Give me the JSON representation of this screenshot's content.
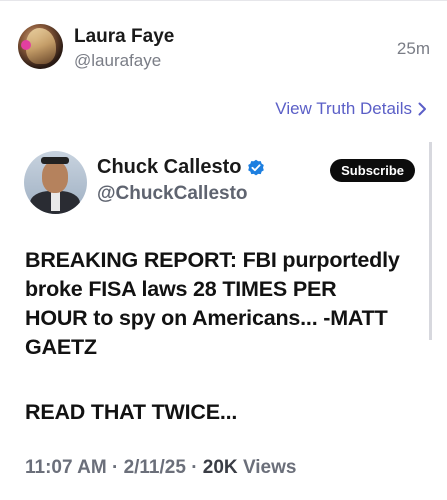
{
  "post": {
    "author_name": "Laura Faye",
    "author_handle": "@laurafaye",
    "time_ago": "25m",
    "view_details_label": "View Truth Details",
    "icons": {
      "chevron": "chevron-right-icon"
    }
  },
  "quoted": {
    "name": "Chuck Callesto",
    "handle": "@ChuckCallesto",
    "subscribe_label": "Subscribe",
    "verified": true,
    "colors": {
      "verified": "#1d7fe0",
      "link": "#5b5fc7"
    },
    "body_lines": [
      "BREAKING REPORT: FBI purportedly",
      "broke FISA laws 28 TIMES PER",
      "HOUR to spy on Americans... -MATT",
      "GAETZ"
    ],
    "body_second": "READ THAT TWICE...",
    "time": "11:07 AM",
    "date": "2/11/25",
    "views_count": "20K",
    "views_label": "Views"
  }
}
